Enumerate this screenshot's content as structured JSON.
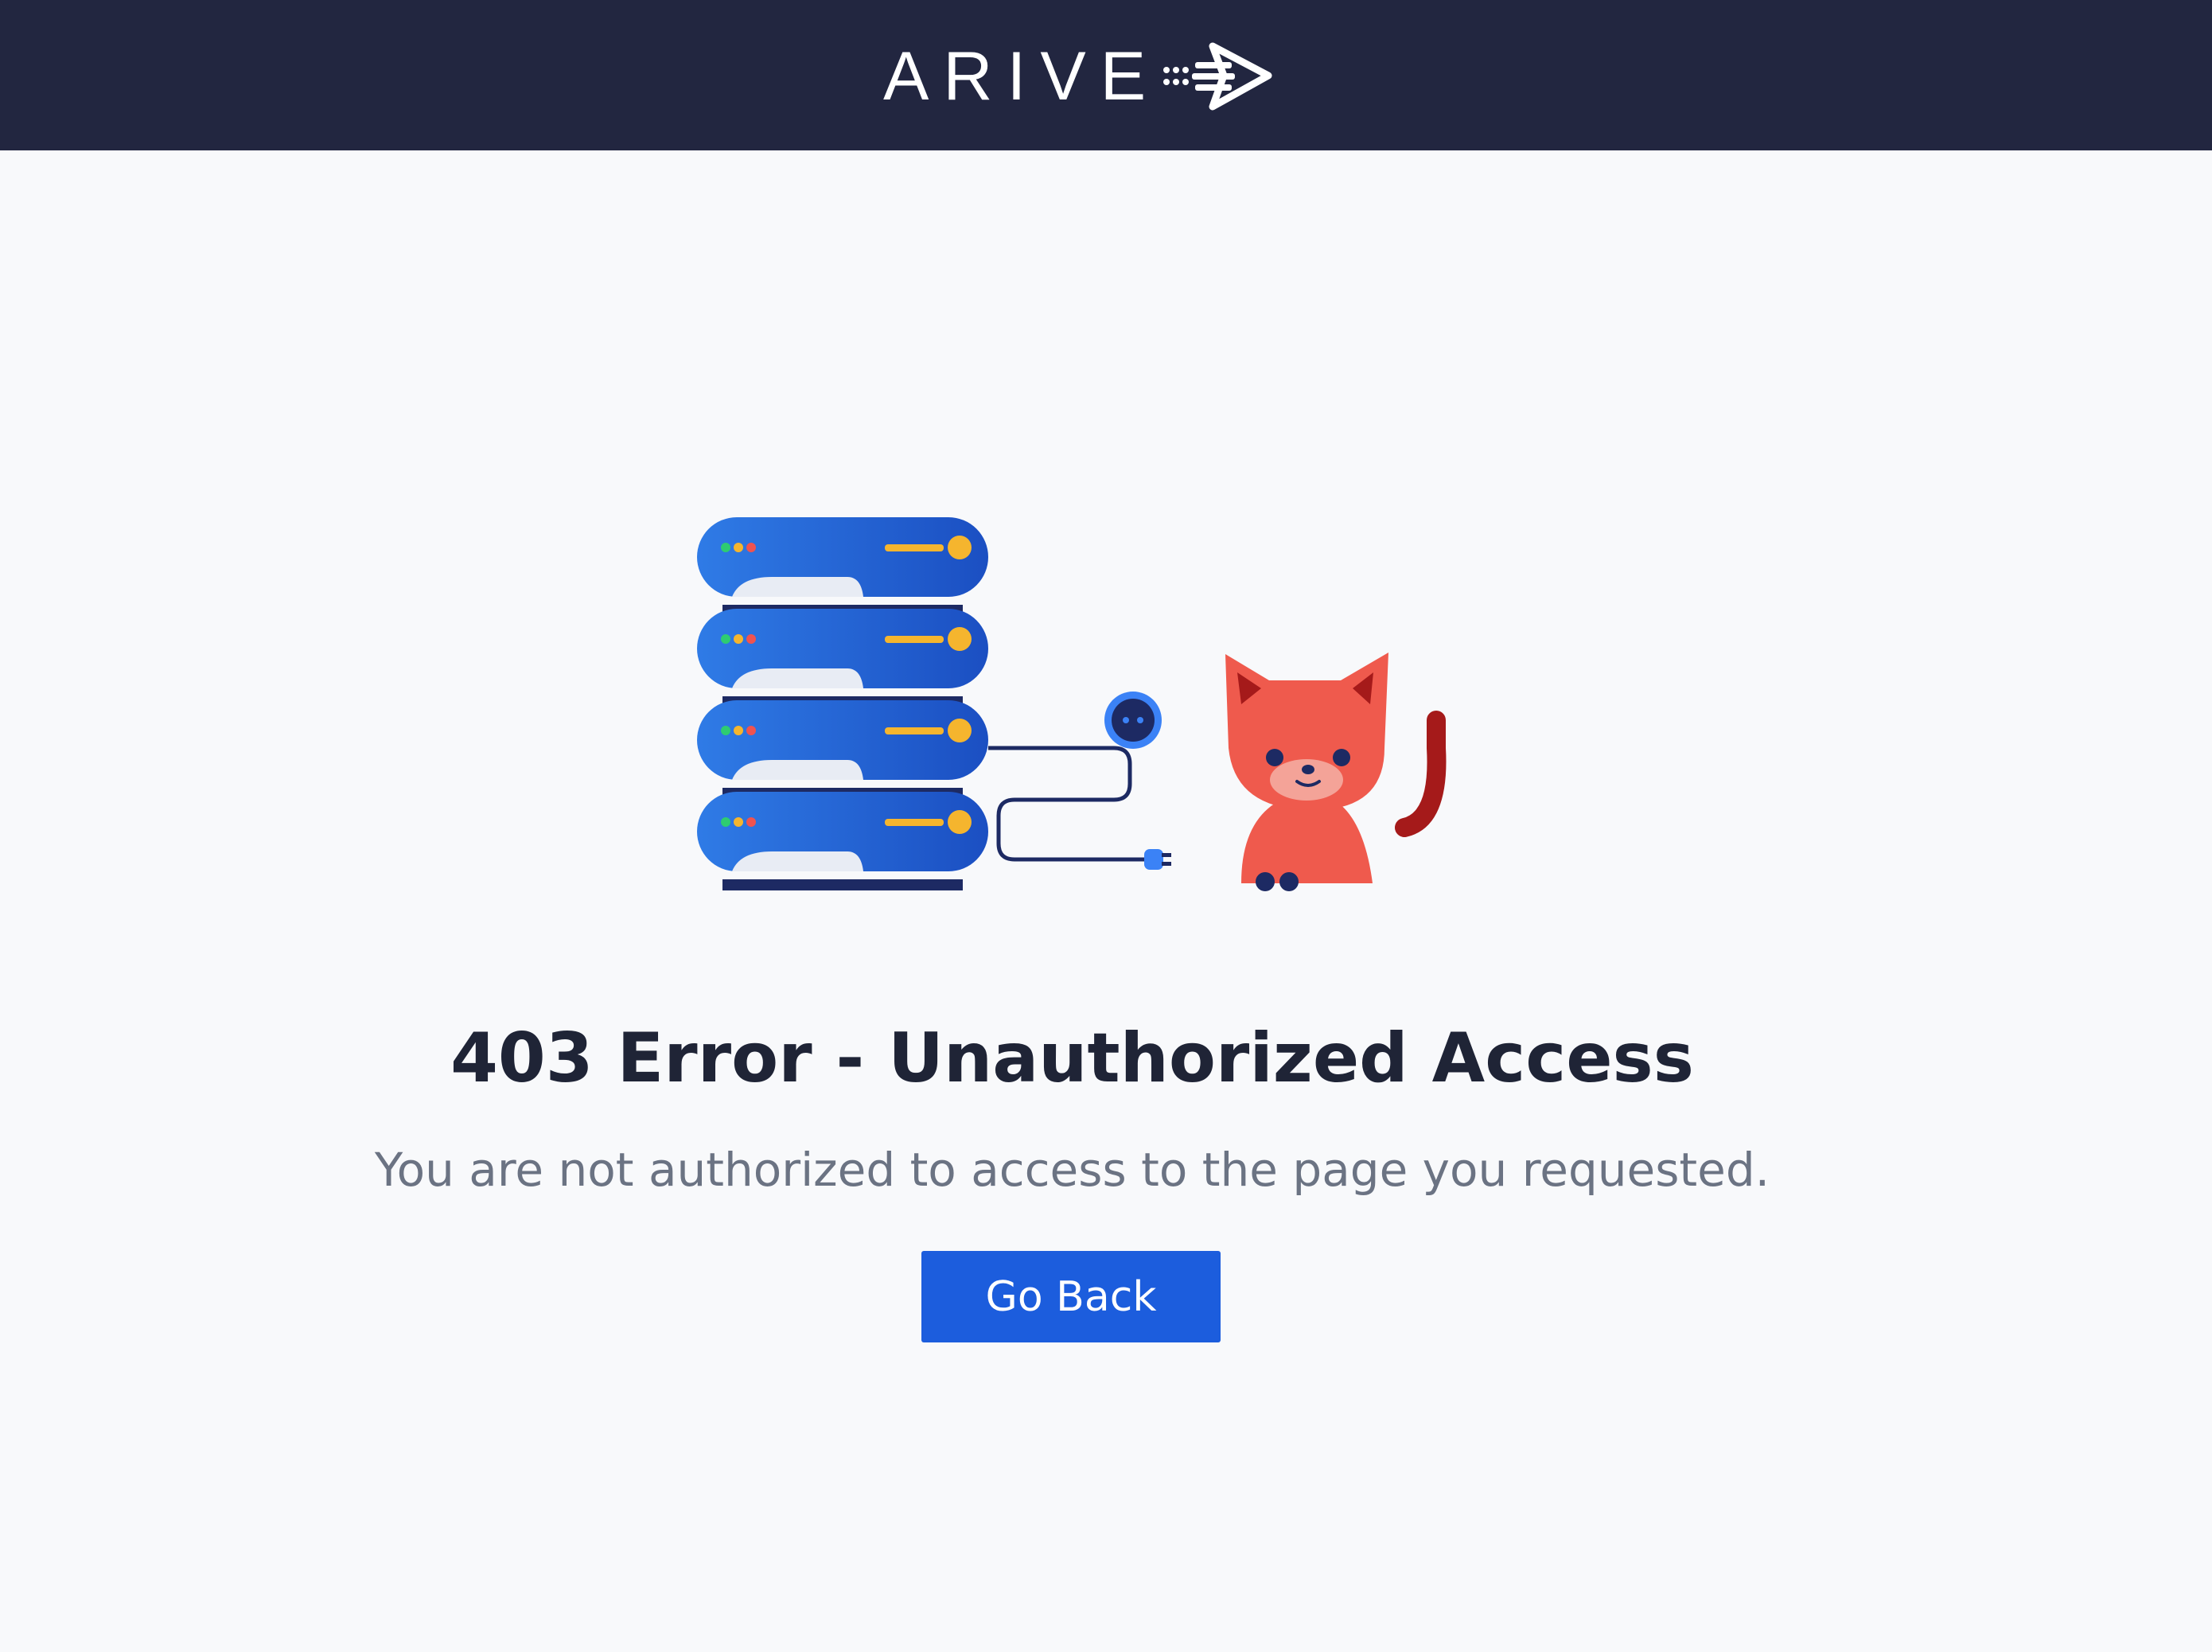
{
  "header": {
    "logo_text": "ARIVE",
    "logo_icon": "speed-arrow-icon",
    "background": "#222640"
  },
  "illustration": {
    "server_icon": "server-stack-icon",
    "plug_icon": "unplugged-cable-icon",
    "socket_icon": "power-socket-icon",
    "cat_icon": "red-cat-icon"
  },
  "error": {
    "title": "403 Error - Unauthorized Access",
    "message": "You are not authorized to access to the page you requested."
  },
  "actions": {
    "go_back_label": "Go Back",
    "accent": "#1c5ddd"
  }
}
